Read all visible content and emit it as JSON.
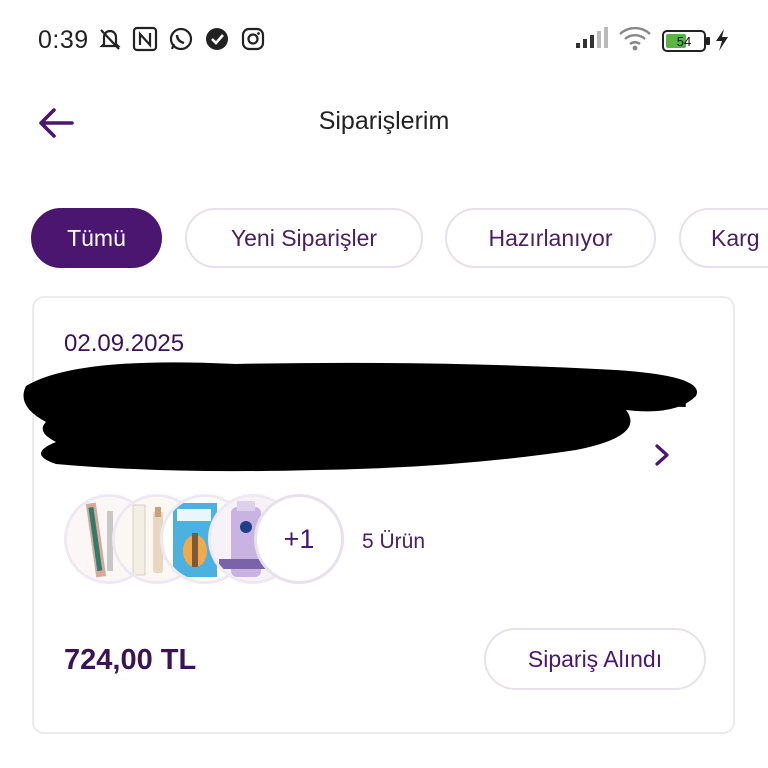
{
  "status_bar": {
    "time": "0:39",
    "battery": "54",
    "left_icons": [
      "bell-off-icon",
      "nfc-icon",
      "whatsapp-icon",
      "check-circle-icon",
      "instagram-icon"
    ],
    "right_icons": [
      "signal-icon",
      "wifi-icon",
      "battery-icon",
      "charging-icon"
    ]
  },
  "header": {
    "title": "Siparişlerim",
    "back_icon": "arrow-left-icon"
  },
  "tabs": [
    {
      "label": "Tümü",
      "active": true
    },
    {
      "label": "Yeni Siparişler",
      "active": false
    },
    {
      "label": "Hazırlanıyor",
      "active": false
    },
    {
      "label": "Karg",
      "active": false
    }
  ],
  "order": {
    "date": "02.09.2025",
    "products_more": "+1",
    "product_count": "5 Ürün",
    "price": "724,00 TL",
    "status": "Sipariş Alındı"
  },
  "colors": {
    "accent": "#4a1670",
    "text_dark": "#3b1456",
    "border": "#e6e1ea"
  }
}
